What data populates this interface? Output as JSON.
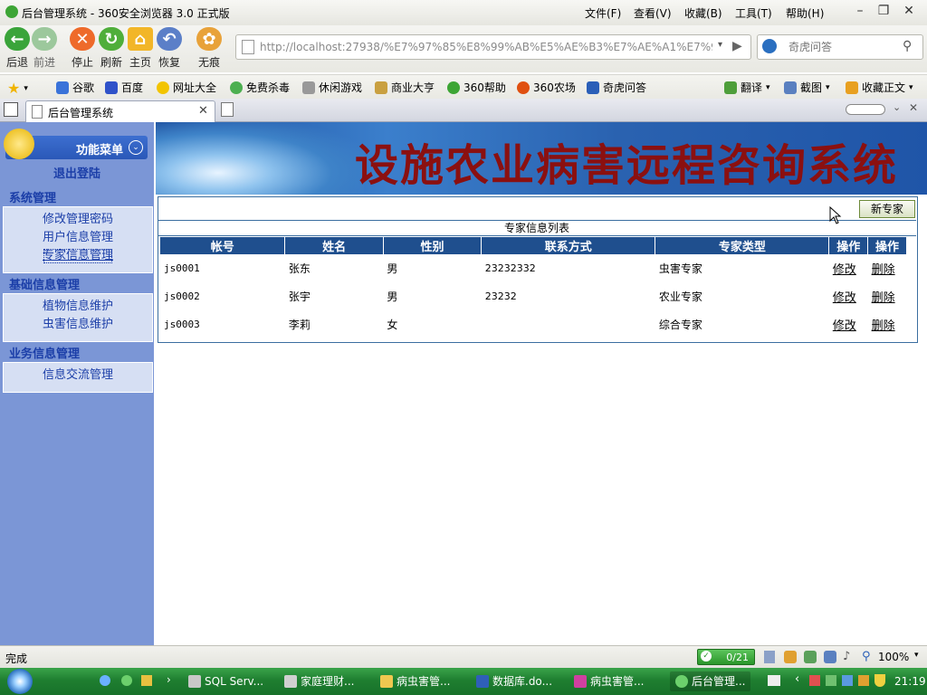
{
  "window": {
    "title": "后台管理系统 - 360安全浏览器 3.0 正式版",
    "menu": [
      "文件(F)",
      "查看(V)",
      "收藏(B)",
      "工具(T)",
      "帮助(H)"
    ]
  },
  "toolbar": {
    "back": "后退",
    "forward": "前进",
    "stop": "停止",
    "refresh": "刷新",
    "home": "主页",
    "restore": "恢复",
    "incognito": "无痕",
    "url": "http://localhost:27938/%E7%97%85%E8%99%AB%E5%AE%B3%E7%AE%A1%E7%90",
    "search_placeholder": "奇虎问答"
  },
  "favorites": [
    "谷歌",
    "百度",
    "网址大全",
    "免费杀毒",
    "休闲游戏",
    "商业大亨",
    "360帮助",
    "360农场",
    "奇虎问答"
  ],
  "favorites_right": [
    "翻译",
    "截图",
    "收藏正文"
  ],
  "tab": {
    "label": "后台管理系统"
  },
  "sidebar": {
    "header": "功能菜单",
    "logout": "退出登陆",
    "groups": [
      {
        "title": "系统管理",
        "items": [
          "修改管理密码",
          "用户信息管理",
          "专家信息管理"
        ]
      },
      {
        "title": "基础信息管理",
        "items": [
          "植物信息维护",
          "虫害信息维护"
        ]
      },
      {
        "title": "业务信息管理",
        "items": [
          "信息交流管理"
        ]
      }
    ]
  },
  "banner": {
    "title": "设施农业病害远程咨询系统"
  },
  "content": {
    "new_button": "新专家",
    "list_title": "专家信息列表",
    "columns": [
      "帐号",
      "姓名",
      "性别",
      "联系方式",
      "专家类型",
      "操作",
      "操作"
    ],
    "rows": [
      {
        "account": "js0001",
        "name": "张东",
        "gender": "男",
        "contact": "23232332",
        "type": "虫害专家",
        "edit": "修改",
        "delete": "删除"
      },
      {
        "account": "js0002",
        "name": "张宇",
        "gender": "男",
        "contact": "23232",
        "type": "农业专家",
        "edit": "修改",
        "delete": "删除"
      },
      {
        "account": "js0003",
        "name": "李莉",
        "gender": "女",
        "contact": "",
        "type": "综合专家",
        "edit": "修改",
        "delete": "删除"
      }
    ]
  },
  "status": {
    "text": "完成",
    "counter": "0/21",
    "zoom": "100%"
  },
  "taskbar": {
    "items": [
      "SQL Serv...",
      "家庭理财...",
      "病虫害管...",
      "数据库.do...",
      "病虫害管...",
      "后台管理..."
    ],
    "clock": "21:19"
  }
}
